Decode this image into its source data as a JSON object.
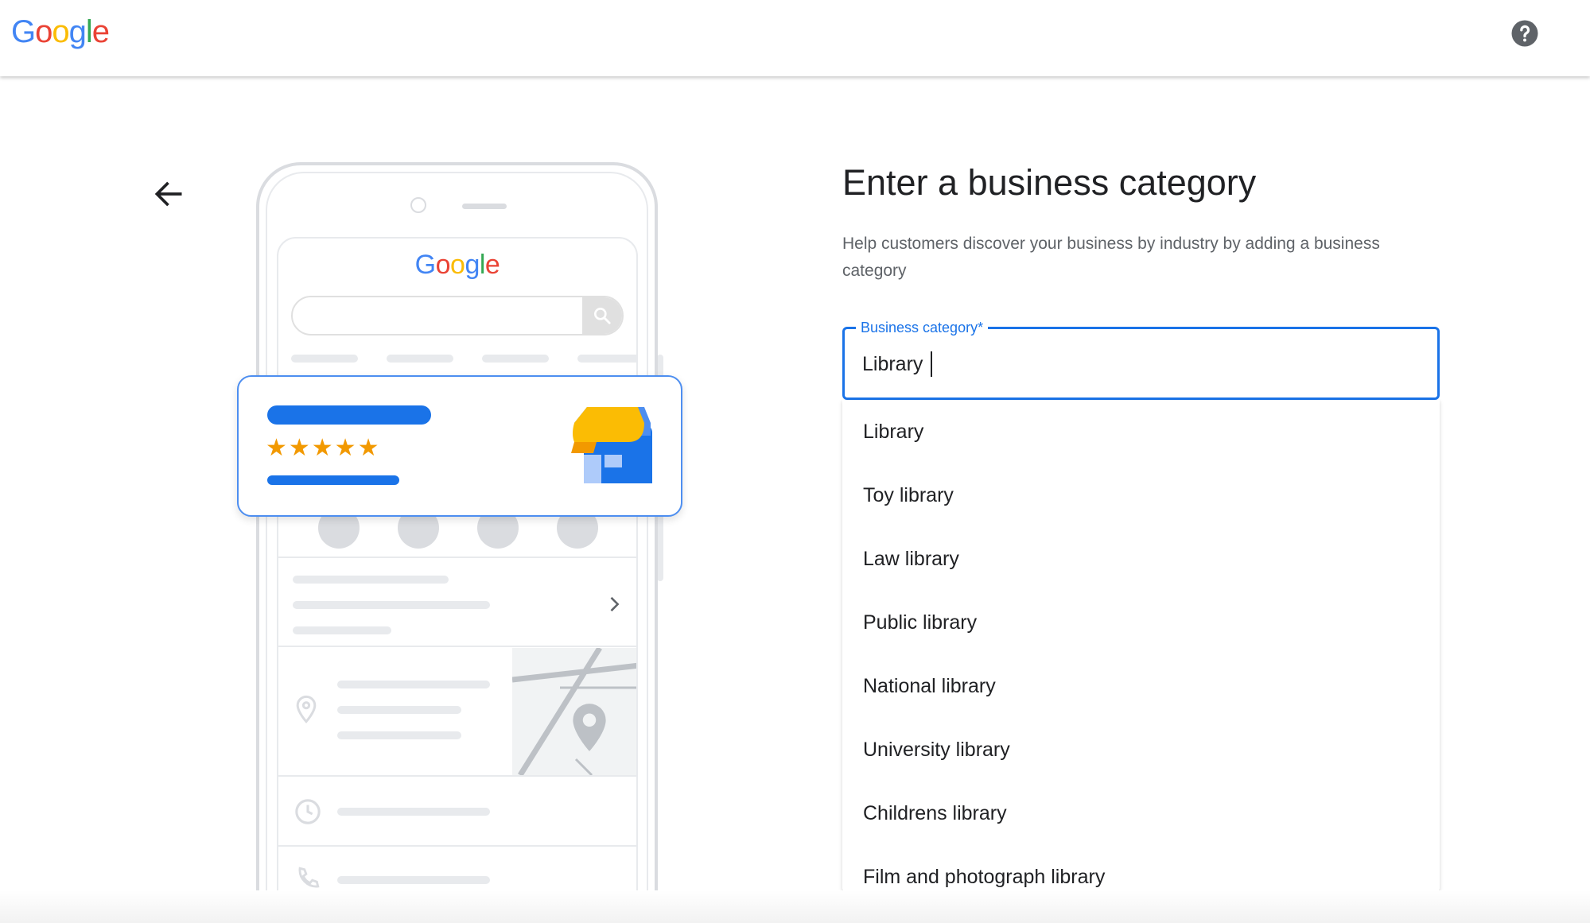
{
  "header": {
    "logo_letters": [
      {
        "char": "G",
        "color": "#4285F4"
      },
      {
        "char": "o",
        "color": "#EA4335"
      },
      {
        "char": "o",
        "color": "#FBBC05"
      },
      {
        "char": "g",
        "color": "#4285F4"
      },
      {
        "char": "l",
        "color": "#34A853"
      },
      {
        "char": "e",
        "color": "#EA4335"
      }
    ],
    "help_icon": "help-circle-icon"
  },
  "navigation": {
    "back_icon": "arrow-back-icon"
  },
  "illustration": {
    "phone_logo": "Google",
    "rating_stars": "★★★★★",
    "colors": {
      "primary_blue": "#1a73e8",
      "star_orange": "#f29900",
      "awning_yellow": "#fbbc04"
    }
  },
  "main": {
    "title": "Enter a business category",
    "description": "Help customers discover your business by industry by adding a business category",
    "field": {
      "label": "Business category*",
      "value": "Library"
    },
    "suggestions": [
      "Library",
      "Toy library",
      "Law library",
      "Public library",
      "National library",
      "University library",
      "Childrens library",
      "Film and photograph library"
    ]
  }
}
